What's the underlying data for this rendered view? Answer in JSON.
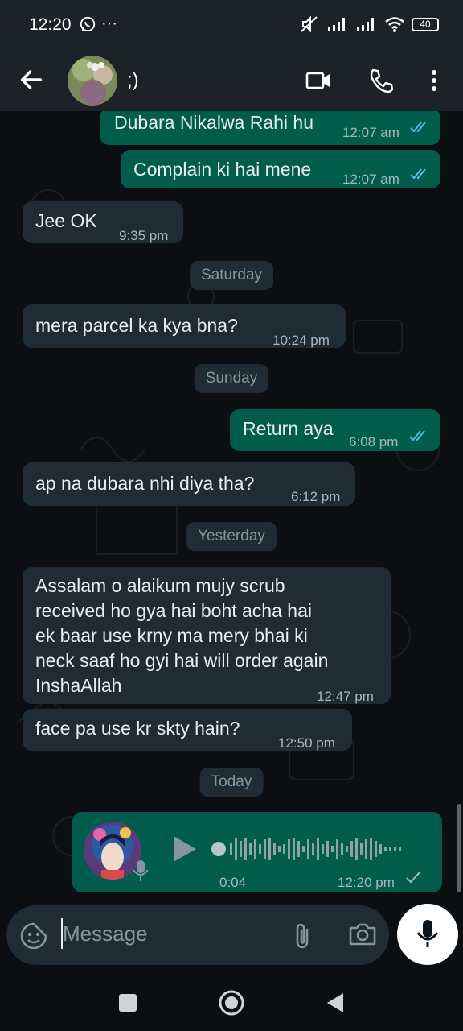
{
  "status_bar": {
    "time": "12:20",
    "dots": "···",
    "battery": "40"
  },
  "header": {
    "contact_name": ";)",
    "icons": [
      "back-arrow-icon",
      "video-call-icon",
      "voice-call-icon",
      "more-menu-icon"
    ]
  },
  "messages": [
    {
      "direction": "out",
      "text": "Dubara Nikalwa Rahi hu",
      "time": "12:07 am",
      "status": "read"
    },
    {
      "direction": "out",
      "text": "Complain ki hai mene",
      "time": "12:07 am",
      "status": "read"
    },
    {
      "direction": "in",
      "text": "Jee OK",
      "time": "9:35 pm"
    },
    {
      "day": "Saturday"
    },
    {
      "direction": "in",
      "text": "mera parcel ka kya bna?",
      "time": "10:24 pm"
    },
    {
      "day": "Sunday"
    },
    {
      "direction": "out",
      "text": "Return aya",
      "time": "6:08 pm",
      "status": "read"
    },
    {
      "direction": "in",
      "text": "ap na dubara nhi diya tha?",
      "time": "6:12 pm"
    },
    {
      "day": "Yesterday"
    },
    {
      "direction": "in",
      "text": "Assalam o alaikum mujy scrub\nreceived ho gya hai boht acha hai\nek baar use krny ma mery bhai ki\nneck saaf ho gyi hai will order again\nInshaAllah",
      "time": "12:47 pm"
    },
    {
      "direction": "in",
      "text": "face pa use kr skty hain?",
      "time": "12:50 pm"
    },
    {
      "day": "Today"
    },
    {
      "direction": "out",
      "type": "voice",
      "duration": "0:04",
      "time": "12:20 pm",
      "status": "sent"
    }
  ],
  "input": {
    "placeholder": "Message"
  },
  "colors": {
    "incoming_bubble": "#1f2c34",
    "outgoing_bubble": "#005c4b",
    "read_ticks": "#53bdeb",
    "background": "#0b0f12"
  }
}
